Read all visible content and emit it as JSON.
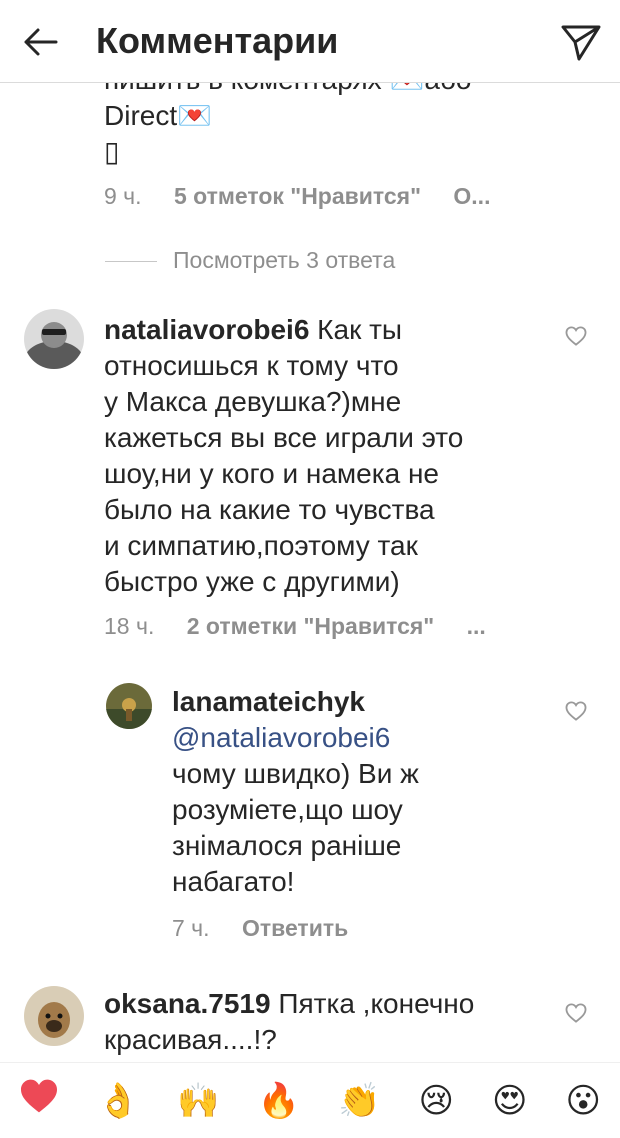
{
  "header": {
    "title": "Комментарии"
  },
  "comments": [
    {
      "text_line1": "пишить в коментарях 💌або",
      "text_line2": "Direct💌",
      "text_line3": "▯",
      "time": "9 ч.",
      "likes": "5 отметок \"Нравится\"",
      "more": "О..."
    },
    {
      "view_replies": "Посмотреть 3 ответа"
    },
    {
      "username": "nataliavorobei6",
      "text_first": " Как ты",
      "lines": [
        "относишься к тому что",
        "у Макса девушка?)мне",
        "кажеться вы все играли это",
        "шоу,ни у кого и намека не",
        "было на какие то чувства",
        "и симпатию,поэтому так",
        "быстро уже с другими)"
      ],
      "time": "18 ч.",
      "likes": "2 отметки \"Нравится\"",
      "more": "..."
    },
    {
      "username": "lanamateichyk",
      "mention": "@nataliavorobei6",
      "lines": [
        "чому швидко) Ви ж",
        "розуміете,що шоу",
        "знімалося раніше",
        "набагато!"
      ],
      "time": "7 ч.",
      "reply": "Ответить"
    },
    {
      "username": "oksana.7519",
      "text_first": " Пятка ,конечно",
      "lines": [
        "красивая....!?"
      ]
    }
  ],
  "emoji_bar": [
    "❤️",
    "👌",
    "🙌",
    "🔥",
    "👏",
    "😢",
    "😍",
    "😮"
  ],
  "colors": {
    "heart": "#ed4956",
    "meta": "#8e8e8e",
    "mention": "#385185"
  }
}
